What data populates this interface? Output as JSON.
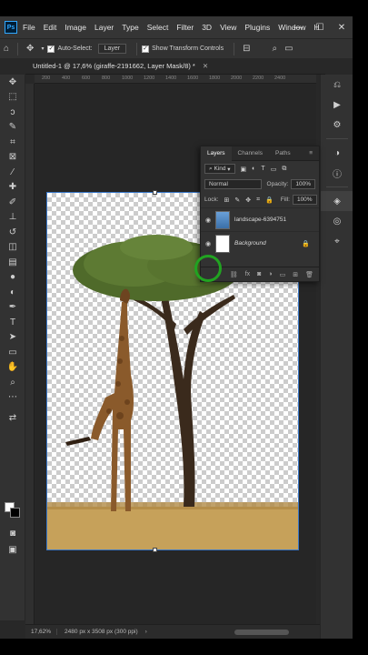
{
  "menubar": {
    "logo": "Ps",
    "items": [
      "File",
      "Edit",
      "Image",
      "Layer",
      "Type",
      "Select",
      "Filter",
      "3D",
      "View",
      "Plugins",
      "Window",
      "H"
    ],
    "controls": [
      "—",
      "☐",
      "✕"
    ]
  },
  "options": {
    "auto_select_label": "Auto-Select:",
    "auto_select_value": "Layer",
    "show_transform_label": "Show Transform Controls"
  },
  "document_tab": {
    "title": "Untitled-1 @ 17,6% (giraffe-2191662, Layer Mask/8) *",
    "close": "✕"
  },
  "ruler": {
    "ticks": [
      "200",
      "400",
      "600",
      "800",
      "1000",
      "1200",
      "1400",
      "1600",
      "1800",
      "2000",
      "2200",
      "2400"
    ]
  },
  "layers_panel": {
    "tabs": [
      "Layers",
      "Channels",
      "Paths"
    ],
    "kind_label": "Kind",
    "blend_mode": "Normal",
    "opacity_label": "Opacity:",
    "opacity_value": "100%",
    "lock_label": "Lock:",
    "fill_label": "Fill:",
    "fill_value": "100%",
    "layers": [
      {
        "name": "landscape-6394751",
        "italic": false
      },
      {
        "name": "Background",
        "italic": true
      }
    ],
    "footer_icons": [
      "link",
      "fx",
      "mask",
      "adjust",
      "folder",
      "new",
      "trash"
    ]
  },
  "status": {
    "zoom": "17,62%",
    "info": "2480 px x 3508 px (300 ppi)"
  },
  "colors": {
    "accent": "#31a8ff",
    "cursor_ring": "#21a321"
  }
}
